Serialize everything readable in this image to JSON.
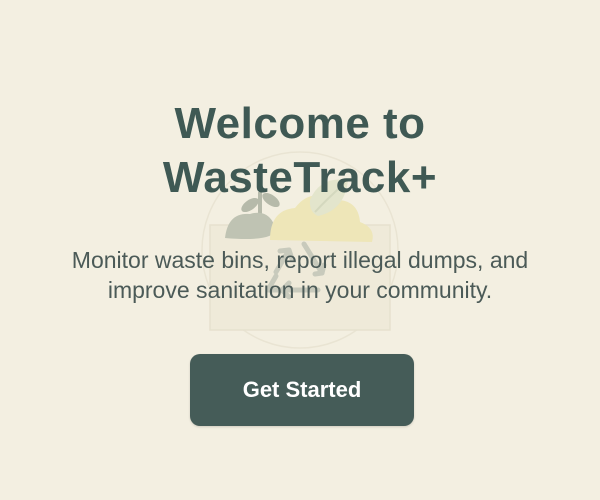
{
  "welcome": {
    "title_line1": "Welcome to",
    "title_line2": "WasteTrack+",
    "subtitle_line1": "Monitor waste bins, report illegal dumps, and",
    "subtitle_line2": "improve sanitation in your community.",
    "cta_label": "Get Started"
  },
  "colors": {
    "background": "#f3efe1",
    "title": "#3f5954",
    "subtitle": "#4b5a57",
    "button": "#455c58",
    "button_text": "#ffffff"
  },
  "icons": {
    "illustration": "recycle-illustration",
    "recycle": "recycle-icon",
    "plant": "plant-icon",
    "leaf": "leaf-icon"
  }
}
